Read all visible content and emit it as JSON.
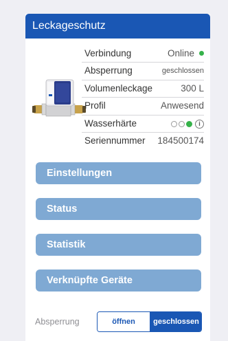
{
  "header": {
    "title": "Leckageschutz"
  },
  "device": {
    "image_name": "leak-protection-valve-icon"
  },
  "info": {
    "connection": {
      "label": "Verbindung",
      "value": "Online",
      "status_color": "#36b24a"
    },
    "shutoff": {
      "label": "Absperrung",
      "value": "geschlossen"
    },
    "volume_leak": {
      "label": "Volumenleckage",
      "value": "300 L"
    },
    "profile": {
      "label": "Profil",
      "value": "Anwesend"
    },
    "hardness": {
      "label": "Wasserhärte",
      "level": 3,
      "max_level": 3,
      "info_icon": "info-icon"
    },
    "serial": {
      "label": "Seriennummer",
      "value": "184500174"
    }
  },
  "menu": {
    "settings": "Einstellungen",
    "status": "Status",
    "statistics": "Statistik",
    "linked_devices": "Verknüpfte Geräte"
  },
  "control": {
    "label": "Absperrung",
    "open": "öffnen",
    "closed": "geschlossen",
    "selected": "geschlossen"
  },
  "colors": {
    "header": "#1a57b4",
    "button": "#7fa9d3",
    "accent": "#1a57b4",
    "online": "#36b24a"
  }
}
